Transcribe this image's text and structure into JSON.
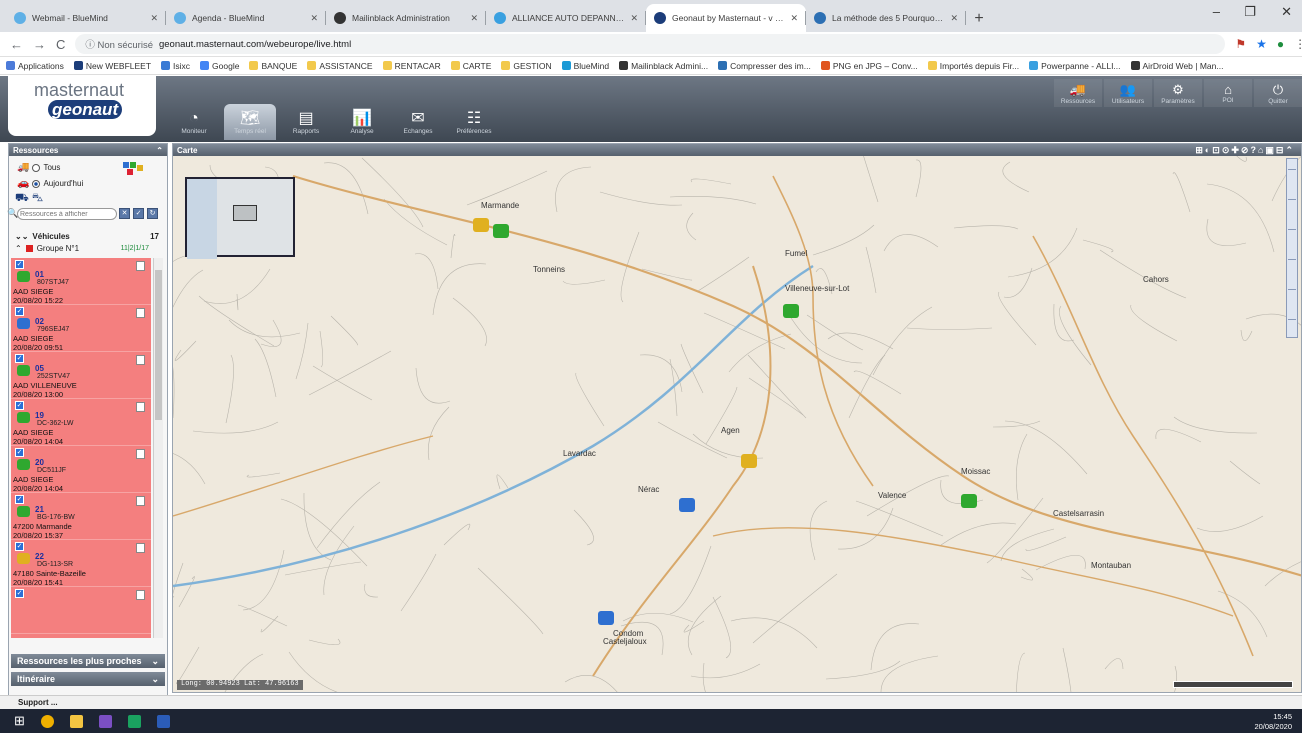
{
  "browser": {
    "tabs": [
      {
        "title": "Webmail - BlueMind",
        "fav": "#5fb0e6"
      },
      {
        "title": "Agenda - BlueMind",
        "fav": "#5fb0e6"
      },
      {
        "title": "Mailinblack Administration",
        "fav": "#333333"
      },
      {
        "title": "ALLIANCE AUTO DEPANNAGE",
        "fav": "#3aa0e0"
      },
      {
        "title": "Geonaut by Masternaut - v 2.12.4",
        "fav": "#1c3d7a"
      },
      {
        "title": "La méthode des 5 Pourquoi pour",
        "fav": "#2c6fb3"
      }
    ],
    "new_tab": "+",
    "minimize": "–",
    "maximize": "❐",
    "close": "✕",
    "back": "←",
    "forward": "→",
    "reload": "C",
    "not_secure": "ⓘ Non sécurisé",
    "url": "geonaut.masternaut.com/webeurope/live.html",
    "bookmarks": [
      "Applications",
      "New WEBFLEET",
      "Isixc",
      "Google",
      "BANQUE",
      "ASSISTANCE",
      "RENTACAR",
      "CARTE",
      "GESTION",
      "BlueMind",
      "Mailinblack Admini...",
      "Compresser des im...",
      "PNG en JPG – Conv...",
      "Importés depuis Fir...",
      "Powerpanne - ALLI...",
      "AirDroid Web | Man..."
    ]
  },
  "app": {
    "logo_top": "masternaut",
    "logo_bottom": "geonaut",
    "nav": [
      {
        "label": "Moniteur",
        "icon": "◔"
      },
      {
        "label": "Temps réel",
        "icon": "🗺"
      },
      {
        "label": "Rapports",
        "icon": "▤"
      },
      {
        "label": "Analyse",
        "icon": "📊"
      },
      {
        "label": "Echanges",
        "icon": "✉"
      },
      {
        "label": "Préférences",
        "icon": "☷"
      }
    ],
    "top_right": [
      {
        "label": "Ressources",
        "icon": "🚚"
      },
      {
        "label": "Utilisateurs",
        "icon": "👥"
      },
      {
        "label": "Paramètres",
        "icon": "⚙"
      },
      {
        "label": "POI",
        "icon": "⌂"
      },
      {
        "label": "Quitter",
        "icon": "⏻"
      }
    ]
  },
  "left_panel": {
    "title": "Ressources",
    "filter_all": "Tous",
    "filter_today": "Aujourd'hui",
    "search_placeholder": "Ressources à afficher",
    "vehicles_label": "Véhicules",
    "vehicles_count": "17",
    "group_label": "Groupe N°1",
    "group_count": "11|2|1/17",
    "vehicles": [
      {
        "num": "01",
        "plate": "807STJ47",
        "site": "AAD SIEGE",
        "date": "20/08/20 15:22",
        "color": "#2fa82f"
      },
      {
        "num": "02",
        "plate": "796SEJ47",
        "site": "AAD SIEGE",
        "date": "20/08/20 09:51",
        "color": "#2e6fd0"
      },
      {
        "num": "05",
        "plate": "252STV47",
        "site": "AAD VILLENEUVE",
        "date": "20/08/20 13:00",
        "color": "#2fa82f"
      },
      {
        "num": "19",
        "plate": "DC-362-LW",
        "site": "AAD SIEGE",
        "date": "20/08/20 14:04",
        "color": "#2fa82f"
      },
      {
        "num": "20",
        "plate": "DC511JF",
        "site": "AAD SIEGE",
        "date": "20/08/20 14:04",
        "color": "#2fa82f"
      },
      {
        "num": "21",
        "plate": "BG-176-BW",
        "site": "47200 Marmande",
        "date": "20/08/20 15:37",
        "color": "#2fa82f"
      },
      {
        "num": "22",
        "plate": "DG-113-SR",
        "site": "47180 Sainte-Bazeille",
        "date": "20/08/20 15:41",
        "color": "#e0b020"
      }
    ],
    "accordion_nearest": "Ressources les plus proches",
    "accordion_itinerary": "Itinéraire",
    "support": "Support ..."
  },
  "map": {
    "title": "Carte",
    "tools": "⊞◐⊡⊙✚⊘?⌂▣⊟⌃",
    "coords": "Long: 00.94923 Lat: 47.96163",
    "towns": [
      {
        "name": "Marmande"
      },
      {
        "name": "Tonneins"
      },
      {
        "name": "Villeneuve-sur-Lot"
      },
      {
        "name": "Agen"
      },
      {
        "name": "Nérac"
      },
      {
        "name": "Moissac"
      },
      {
        "name": "Montauban"
      },
      {
        "name": "Cahors"
      },
      {
        "name": "Casteljaloux"
      },
      {
        "name": "Fumel"
      },
      {
        "name": "Valence"
      },
      {
        "name": "Lavardac"
      },
      {
        "name": "Condom"
      },
      {
        "name": "Castelsarrasin"
      }
    ],
    "vehicle_markers": [
      {
        "color": "#e0b020"
      },
      {
        "color": "#2fa82f"
      },
      {
        "color": "#2fa82f"
      },
      {
        "color": "#e0b020"
      },
      {
        "color": "#2e6fd0"
      },
      {
        "color": "#2fa82f"
      },
      {
        "color": "#2e6fd0"
      }
    ]
  },
  "taskbar": {
    "time": "15:45",
    "date": "20/08/2020"
  }
}
